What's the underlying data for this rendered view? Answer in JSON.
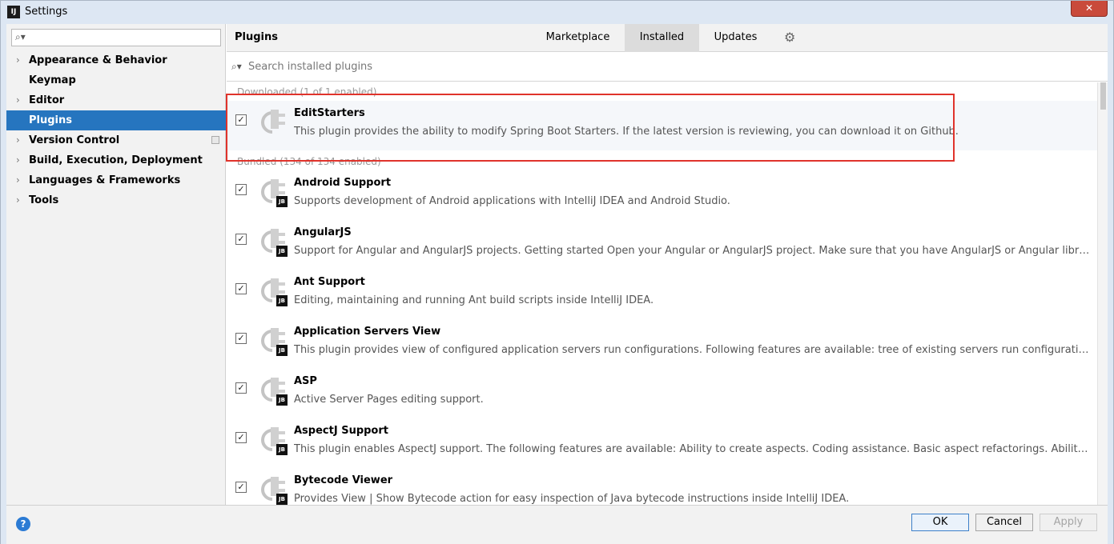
{
  "window": {
    "title": "Settings",
    "app_icon_text": "IJ",
    "close_label": "✕"
  },
  "sidebar": {
    "search_placeholder": "",
    "items": [
      {
        "label": "Appearance & Behavior",
        "expandable": true
      },
      {
        "label": "Keymap",
        "expandable": false
      },
      {
        "label": "Editor",
        "expandable": true
      },
      {
        "label": "Plugins",
        "expandable": false,
        "selected": true
      },
      {
        "label": "Version Control",
        "expandable": true
      },
      {
        "label": "Build, Execution, Deployment",
        "expandable": true
      },
      {
        "label": "Languages & Frameworks",
        "expandable": true
      },
      {
        "label": "Tools",
        "expandable": true
      }
    ]
  },
  "main": {
    "title": "Plugins",
    "tabs": [
      {
        "label": "Marketplace",
        "active": false
      },
      {
        "label": "Installed",
        "active": true
      },
      {
        "label": "Updates",
        "active": false
      }
    ],
    "search_placeholder": "Search installed plugins",
    "groups": {
      "downloaded": "Downloaded (1 of 1 enabled)",
      "bundled": "Bundled (134 of 134 enabled)"
    },
    "downloaded_plugins": [
      {
        "name": "EditStarters",
        "description": "This plugin provides the ability to modify Spring Boot Starters. If the latest version is reviewing, you can download it on Github.",
        "checked": true,
        "jb": false
      }
    ],
    "bundled_plugins": [
      {
        "name": "Android Support",
        "description": "Supports development of Android applications with IntelliJ IDEA and Android Studio.",
        "checked": true,
        "jb": true
      },
      {
        "name": "AngularJS",
        "description": "Support for Angular and AngularJS projects. Getting started Open your Angular or AngularJS project. Make sure that you have AngularJS or Angular library files in your...",
        "checked": true,
        "jb": true
      },
      {
        "name": "Ant Support",
        "description": "Editing, maintaining and running Ant build scripts inside IntelliJ IDEA.",
        "checked": true,
        "jb": true
      },
      {
        "name": "Application Servers View",
        "description": "This plugin provides view of configured application servers run configurations. Following features are available: tree of existing servers run configuration and their artifacts...",
        "checked": true,
        "jb": true
      },
      {
        "name": "ASP",
        "description": "Active Server Pages editing support.",
        "checked": true,
        "jb": true
      },
      {
        "name": "AspectJ Support",
        "description": "This plugin enables AspectJ support. The following features are available: Ability to create aspects. Coding assistance. Basic aspect refactorings. Ability to launch AspectJ...",
        "checked": true,
        "jb": true
      },
      {
        "name": "Bytecode Viewer",
        "description": "Provides View | Show Bytecode action for easy inspection of Java bytecode instructions inside IntelliJ IDEA.",
        "checked": true,
        "jb": true
      }
    ],
    "jb_badge": "JB"
  },
  "footer": {
    "help_label": "?",
    "ok_label": "OK",
    "cancel_label": "Cancel",
    "apply_label": "Apply"
  },
  "colors": {
    "selection": "#2675bf",
    "highlight_box": "#e0332b",
    "primary_button_border": "#3d80c9"
  }
}
